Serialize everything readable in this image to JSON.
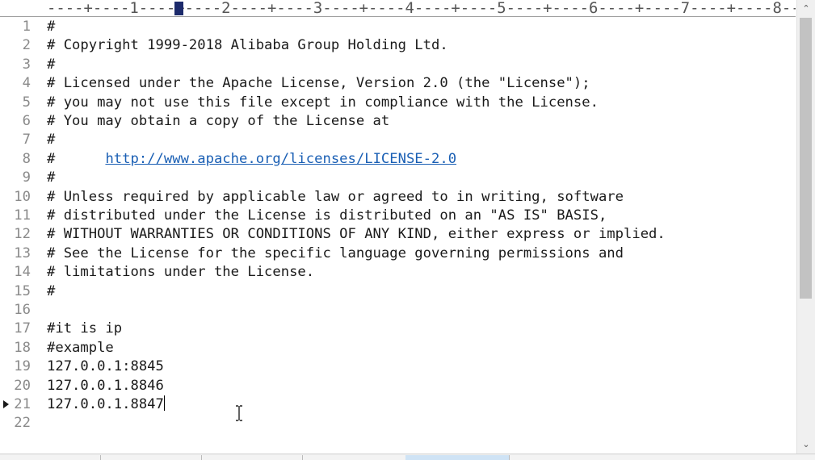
{
  "ruler": {
    "text": "----+----1----+----2----+----3----+----4----+----5----+----6----+----7----+----8--"
  },
  "editor": {
    "current_line": "21",
    "lines": [
      {
        "n": "1",
        "text": "#"
      },
      {
        "n": "2",
        "text": "# Copyright 1999-2018 Alibaba Group Holding Ltd."
      },
      {
        "n": "3",
        "text": "#"
      },
      {
        "n": "4",
        "text": "# Licensed under the Apache License, Version 2.0 (the \"License\");"
      },
      {
        "n": "5",
        "text": "# you may not use this file except in compliance with the License."
      },
      {
        "n": "6",
        "text": "# You may obtain a copy of the License at"
      },
      {
        "n": "7",
        "text": "#"
      },
      {
        "n": "8",
        "prefix": "#      ",
        "url": "http://www.apache.org/licenses/LICENSE-2.0"
      },
      {
        "n": "9",
        "text": "#"
      },
      {
        "n": "10",
        "text": "# Unless required by applicable law or agreed to in writing, software"
      },
      {
        "n": "11",
        "text": "# distributed under the License is distributed on an \"AS IS\" BASIS,"
      },
      {
        "n": "12",
        "text": "# WITHOUT WARRANTIES OR CONDITIONS OF ANY KIND, either express or implied."
      },
      {
        "n": "13",
        "text": "# See the License for the specific language governing permissions and"
      },
      {
        "n": "14",
        "text": "# limitations under the License."
      },
      {
        "n": "15",
        "text": "#"
      },
      {
        "n": "16",
        "text": ""
      },
      {
        "n": "17",
        "text": "#it is ip"
      },
      {
        "n": "18",
        "text": "#example"
      },
      {
        "n": "19",
        "text": "127.0.0.1:8845"
      },
      {
        "n": "20",
        "text": "127.0.0.1.8846"
      },
      {
        "n": "21",
        "text": "127.0.0.1.8847"
      },
      {
        "n": "22",
        "text": ""
      }
    ]
  },
  "scrollbar": {
    "up_icon": "chevron-up-icon",
    "down_icon": "chevron-down-icon"
  },
  "colors": {
    "line_number": "#8a8a8a",
    "text": "#1a1a1a",
    "link": "#1a5fb4",
    "ruler_cursor": "#1c2a6b",
    "active_tab": "#cfe3f5"
  }
}
